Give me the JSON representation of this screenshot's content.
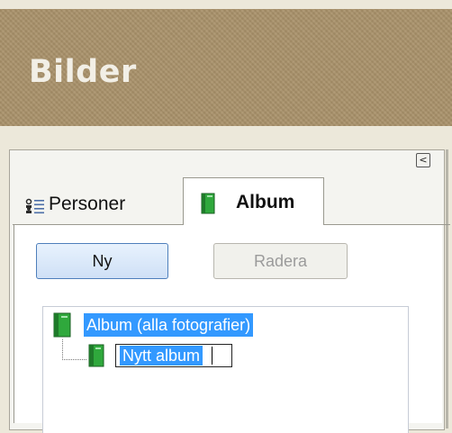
{
  "header": {
    "title": "Bilder"
  },
  "panel": {
    "collapse_label": "<",
    "tabs": [
      {
        "label": "Personer",
        "icon": "people-list-icon",
        "selected": false
      },
      {
        "label": "Album",
        "icon": "album-book-icon",
        "selected": true
      }
    ],
    "buttons": {
      "new_label": "Ny",
      "delete_label": "Radera",
      "delete_enabled": false
    },
    "tree": {
      "root_label": "Album (alla fotografier)",
      "child_edit_value": "Nytt album"
    }
  },
  "colors": {
    "header_bg": "#a9926a",
    "selection": "#3399ff",
    "album_green": "#2fa83c"
  }
}
